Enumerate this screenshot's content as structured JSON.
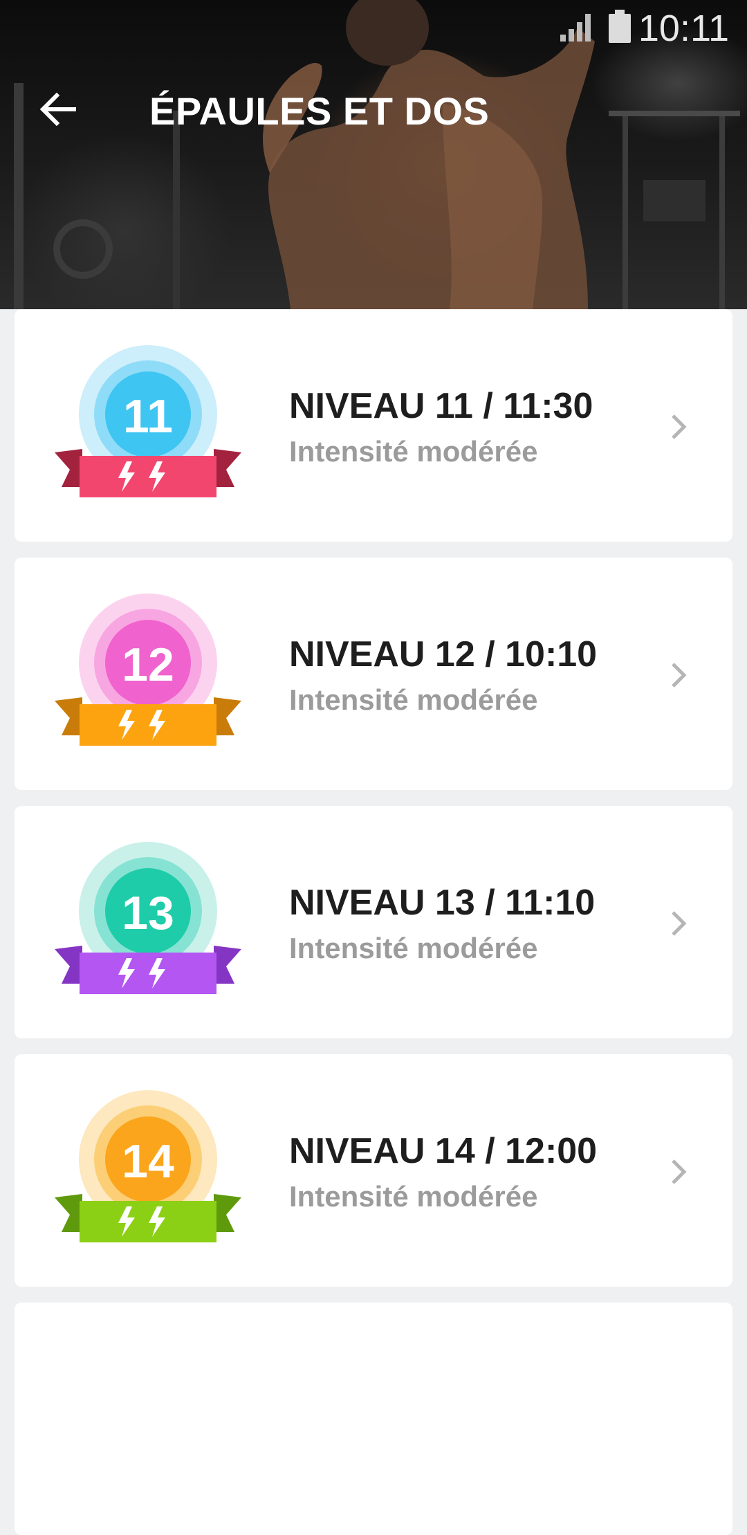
{
  "status_bar": {
    "time": "10:11"
  },
  "header": {
    "title": "ÉPAULES ET DOS",
    "back_icon": "arrow-back-icon"
  },
  "levels": [
    {
      "badge_number": "11",
      "title": "NIVEAU 11 / 11:30",
      "subtitle": "Intensité modérée",
      "colors": {
        "halo": "#cdeefb",
        "ring": "#8fdcf8",
        "core": "#3ec5f2",
        "ribbon": "#f2466f",
        "ribbon_tail": "#a3233f"
      }
    },
    {
      "badge_number": "12",
      "title": "NIVEAU 12 / 10:10",
      "subtitle": "Intensité modérée",
      "colors": {
        "halo": "#fcd3ef",
        "ring": "#f8a6e2",
        "core": "#f062cd",
        "ribbon": "#fca30f",
        "ribbon_tail": "#c97c0a"
      }
    },
    {
      "badge_number": "13",
      "title": "NIVEAU 13 / 11:10",
      "subtitle": "Intensité modérée",
      "colors": {
        "halo": "#c9f1ea",
        "ring": "#86e3d3",
        "core": "#1fcca9",
        "ribbon": "#b356f2",
        "ribbon_tail": "#8535c4"
      }
    },
    {
      "badge_number": "14",
      "title": "NIVEAU 14 / 12:00",
      "subtitle": "Intensité modérée",
      "colors": {
        "halo": "#fde8bf",
        "ring": "#fccf76",
        "core": "#fba51c",
        "ribbon": "#8cd016",
        "ribbon_tail": "#5e9a0c"
      }
    }
  ]
}
